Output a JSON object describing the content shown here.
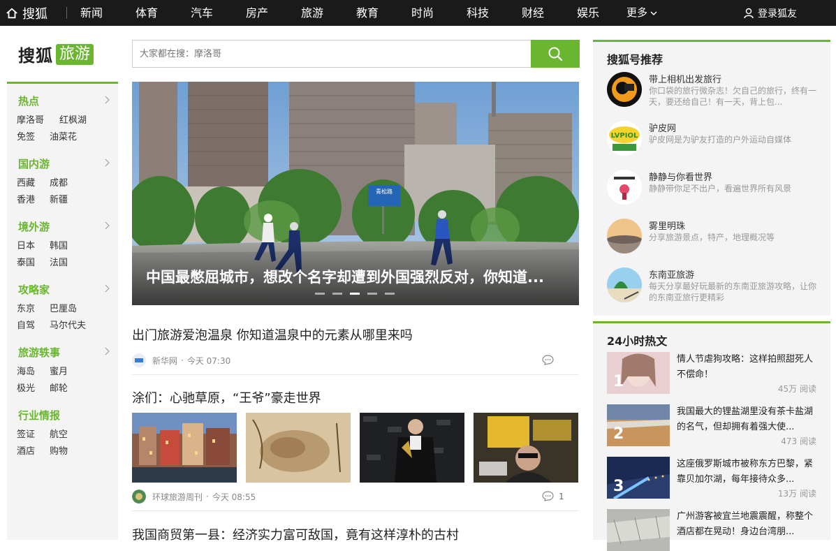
{
  "topnav": {
    "logo": "搜狐",
    "items": [
      "新闻",
      "体育",
      "汽车",
      "房产",
      "旅游",
      "教育",
      "时尚",
      "科技",
      "财经",
      "娱乐"
    ],
    "more": "更多",
    "login": "登录狐友"
  },
  "brand": {
    "name": "搜狐",
    "tag": "旅游"
  },
  "leftnav": [
    {
      "title": "热点",
      "items": [
        "摩洛哥",
        "红枫湖",
        "免签",
        "油菜花"
      ]
    },
    {
      "title": "国内游",
      "items": [
        "西藏",
        "成都",
        "香港",
        "新疆"
      ]
    },
    {
      "title": "境外游",
      "items": [
        "日本",
        "韩国",
        "泰国",
        "法国"
      ]
    },
    {
      "title": "攻略家",
      "items": [
        "东京",
        "巴厘岛",
        "自驾",
        "马尔代夫"
      ]
    },
    {
      "title": "旅游轶事",
      "items": [
        "海岛",
        "蜜月",
        "极光",
        "邮轮"
      ]
    },
    {
      "title": "行业情报",
      "items": [
        "签证",
        "航空",
        "酒店",
        "购物"
      ]
    }
  ],
  "search": {
    "placeholder": "大家都在搜：摩洛哥"
  },
  "hero": {
    "caption": "中国最憋屈城市，想改个名字却遭到外国强烈反对，你知道...",
    "dots": 5,
    "active_dot": 3,
    "sign_text": "青松路"
  },
  "articles": [
    {
      "title": "出门旅游爱泡温泉 你知道温泉中的元素从哪里来吗",
      "source": "新华网",
      "time": "今天 07:30",
      "comments": ""
    },
    {
      "title": "涂们：心驰草原，“王爷”豪走世界",
      "source": "环球旅游周刊",
      "time": "今天 08:55",
      "comments": "1"
    },
    {
      "title": "我国商贸第一县：经济实力富可敌国，竟有这样淳朴的古村"
    }
  ],
  "recommend": {
    "title": "搜狐号推荐",
    "accounts": [
      {
        "name": "带上相机出发旅行",
        "desc": "你口袋的旅行微杂志！欠自己的旅行，终有一天，要还给自己！有一天，背上包..."
      },
      {
        "name": "驴皮网",
        "desc": "驴皮网是为驴友打造的户外运动自媒体",
        "logo_text": "LVPIOL"
      },
      {
        "name": "静静与你看世界",
        "desc": "静静带你足不出户，看遍世界所有风景"
      },
      {
        "name": "雾里明珠",
        "desc": "分享旅游景点，特产，地理概况等"
      },
      {
        "name": "东南亚旅游",
        "desc": "每天分享最好玩最新的东南亚旅游攻略，让你的东南亚旅行更精彩"
      }
    ]
  },
  "hot24": {
    "title": "24小时热文",
    "items": [
      {
        "rank": "1",
        "title": "情人节虐狗攻略：这样拍照甜死人不偿命！",
        "reads": "45万 阅读"
      },
      {
        "rank": "2",
        "title": "我国最大的锂盐湖里没有茶卡盐湖的名气，但却拥有着强大使...",
        "reads": "473 阅读"
      },
      {
        "rank": "3",
        "title": "这座俄罗斯城市被称东方巴黎，紧靠贝加尔湖，每年接待众多...",
        "reads": "13万 阅读"
      },
      {
        "rank": "",
        "title": "广州游客被宜兰地震震醒，称整个酒店都在晃动！身边台湾朋...",
        "reads": ""
      }
    ]
  }
}
